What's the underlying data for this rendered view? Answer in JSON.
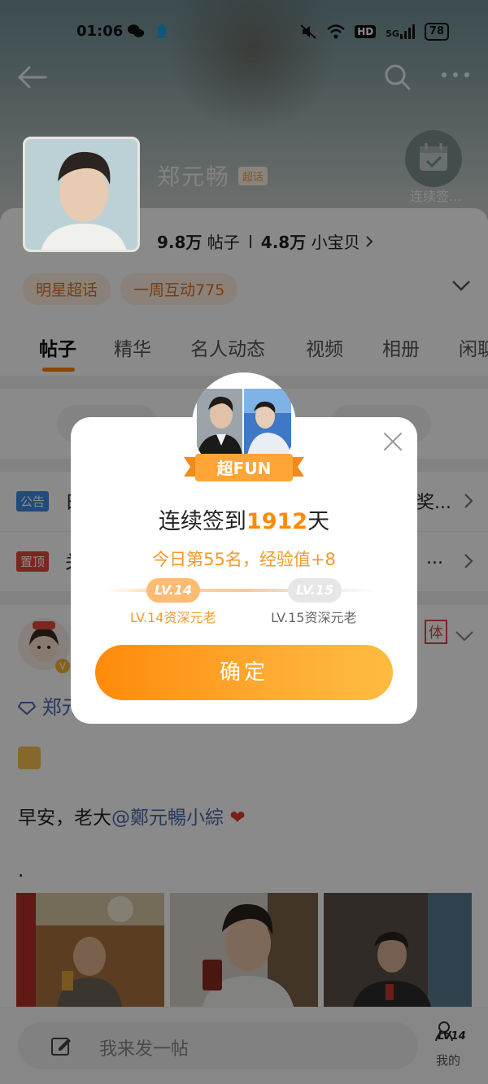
{
  "status_bar": {
    "time": "01:06",
    "signal_label": "5G",
    "hd_label": "HD",
    "battery": "78"
  },
  "header": {
    "name": "郑元畅",
    "badge": "超话",
    "checkin_label": "连续签..."
  },
  "stats": {
    "posts_value": "9.8万",
    "posts_label": "帖子",
    "fans_value": "4.8万",
    "fans_label": "小宝贝"
  },
  "tags": [
    "明星超话",
    "一周互动775"
  ],
  "tabs": [
    "帖子",
    "精华",
    "名人动态",
    "视频",
    "相册",
    "闲聊"
  ],
  "notices": [
    {
      "badge": "公告",
      "text": "日",
      "tail": "奖..."
    },
    {
      "badge": "置顶",
      "text": "关",
      "tail": "..."
    }
  ],
  "post": {
    "avatar_badge": "V",
    "side_badge": "体",
    "name": "郑元",
    "body_prefix": "早安，老大",
    "mention": "@鄭元暢小綜",
    "heart": "❤",
    "dot": "."
  },
  "bottom": {
    "compose_placeholder": "我来发一帖",
    "level_badge": "LV14",
    "me_label": "我的"
  },
  "dialog": {
    "ribbon_label": "超FUN",
    "title_prefix": "连续签到",
    "title_days": "1912",
    "title_suffix": "天",
    "subtitle": "今日第55名，经验值+8",
    "current_level_pill": "LV.14",
    "next_level_pill": "LV.15",
    "current_level_caption": "LV.14资深元老",
    "next_level_caption": "LV.15资深元老",
    "confirm_label": "确定"
  },
  "colors": {
    "accent": "#ff8a00",
    "link": "#4b6aa8",
    "tag_text": "#e66d1b",
    "mask": "rgba(0,0,0,0.46)"
  },
  "icons": [
    "back-arrow-icon",
    "search-icon",
    "more-icon",
    "calendar-check-icon",
    "chevron-down-icon",
    "chevron-right-icon",
    "close-icon",
    "edit-icon",
    "user-icon"
  ]
}
